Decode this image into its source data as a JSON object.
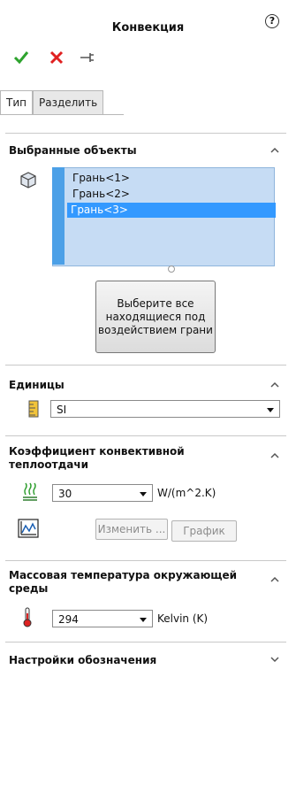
{
  "header": {
    "title": "Конвекция",
    "help": "?"
  },
  "tabs": [
    {
      "label": "Тип"
    },
    {
      "label": "Разделить"
    }
  ],
  "selected_entities": {
    "title": "Выбранные объекты",
    "items": [
      {
        "label": "Грань<1>"
      },
      {
        "label": "Грань<2>"
      },
      {
        "label": "Грань<3>"
      }
    ],
    "select_all_button": "Выберите все находящиеся под воздействием грани"
  },
  "units": {
    "title": "Единицы",
    "value": "SI"
  },
  "convection_coefficient": {
    "title": "Коэффициент конвективной теплоотдачи",
    "value": "30",
    "unit": "W/(m^2.K)",
    "edit_button": "Изменить ...",
    "graph_button": "График"
  },
  "bulk_temperature": {
    "title": "Массовая температура окружающей среды",
    "value": "294",
    "unit": "Kelvin (K)"
  },
  "symbol_settings": {
    "title": "Настройки обозначения"
  },
  "colors": {
    "accept": "#2ea32e",
    "cancel": "#e02020",
    "selection": "#3399ff",
    "list_bg": "#c6dcf4"
  }
}
